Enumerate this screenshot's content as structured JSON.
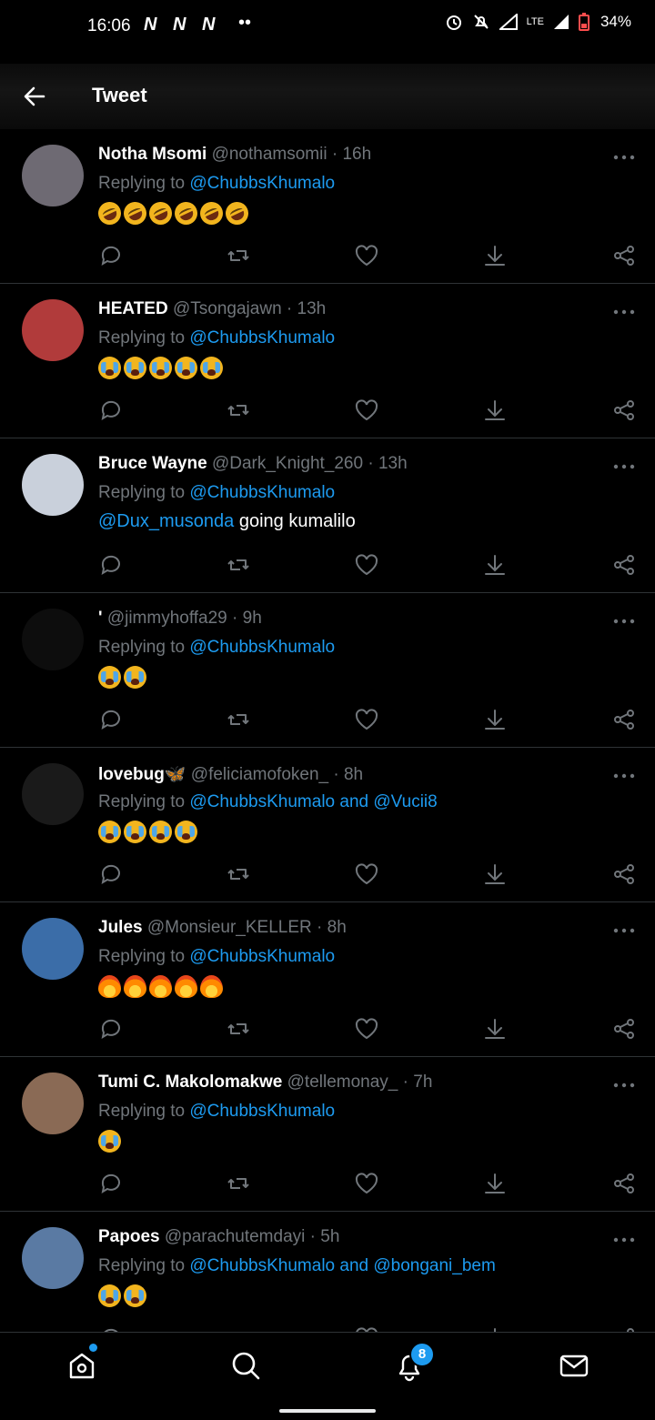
{
  "status_bar": {
    "time": "16:06",
    "app_icons": "N N N",
    "more_dots": "••",
    "network_label": "LTE",
    "battery": "34%"
  },
  "header": {
    "title": "Tweet",
    "back_icon": "arrow-left-icon"
  },
  "reply_prefix": "Replying to",
  "tweets": [
    {
      "name": "Notha Msomi",
      "handle": "@nothamsomii",
      "time": "· 16h",
      "reply_to": "@ChubbsKhumalo",
      "emojis": [
        "rofl",
        "rofl",
        "rofl",
        "rofl",
        "rofl",
        "rofl"
      ],
      "avatar_color": "#6e6a73"
    },
    {
      "name": "HEATED",
      "handle": "@Tsongajawn",
      "time": "· 13h",
      "reply_to": "@ChubbsKhumalo",
      "emojis": [
        "sob",
        "sob",
        "sob",
        "sob",
        "sob"
      ],
      "avatar_color": "#b13b3b"
    },
    {
      "name": "Bruce Wayne",
      "handle": "@Dark_Knight_260",
      "time": "· 13h",
      "reply_to": "@ChubbsKhumalo",
      "body_mention": "@Dux_musonda",
      "body_text": " going kumalilo",
      "avatar_color": "#c9d0db"
    },
    {
      "name": "'",
      "handle": "@jimmyhoffa29",
      "time": "· 9h",
      "reply_to": "@ChubbsKhumalo",
      "emojis": [
        "sob",
        "sob"
      ],
      "avatar_color": "#0d0d0d"
    },
    {
      "name": "lovebug🦋",
      "handle": "@feliciamofoken_",
      "time": "· 8h",
      "reply_to": "@ChubbsKhumalo and @Vucii8",
      "emojis": [
        "sob",
        "sob",
        "sob",
        "sob"
      ],
      "avatar_color": "#1a1a1a"
    },
    {
      "name": "Jules",
      "handle": "@Monsieur_KELLER",
      "time": "· 8h",
      "reply_to": "@ChubbsKhumalo",
      "emojis": [
        "fire",
        "fire",
        "fire",
        "fire",
        "fire"
      ],
      "avatar_color": "#3b6da8"
    },
    {
      "name": "Tumi C. Makolomakwe",
      "handle": "@tellemonay_",
      "time": "· 7h",
      "reply_to": "@ChubbsKhumalo",
      "emojis": [
        "sob"
      ],
      "avatar_color": "#8a6a55"
    },
    {
      "name": "Papoes",
      "handle": "@parachutemdayi",
      "time": "· 5h",
      "reply_to": "@ChubbsKhumalo and @bongani_bem",
      "emojis": [
        "sob",
        "sob"
      ],
      "avatar_color": "#5a7aa3"
    }
  ],
  "tweet_actions": [
    "reply-icon",
    "retweet-icon",
    "like-icon",
    "download-icon",
    "share-icon"
  ],
  "bottom_nav": {
    "items": [
      "home-icon",
      "search-icon",
      "notifications-icon",
      "messages-icon"
    ],
    "notification_count": "8"
  },
  "colors": {
    "accent": "#1d9bf0",
    "background": "#000000",
    "muted_text": "#71767b"
  }
}
